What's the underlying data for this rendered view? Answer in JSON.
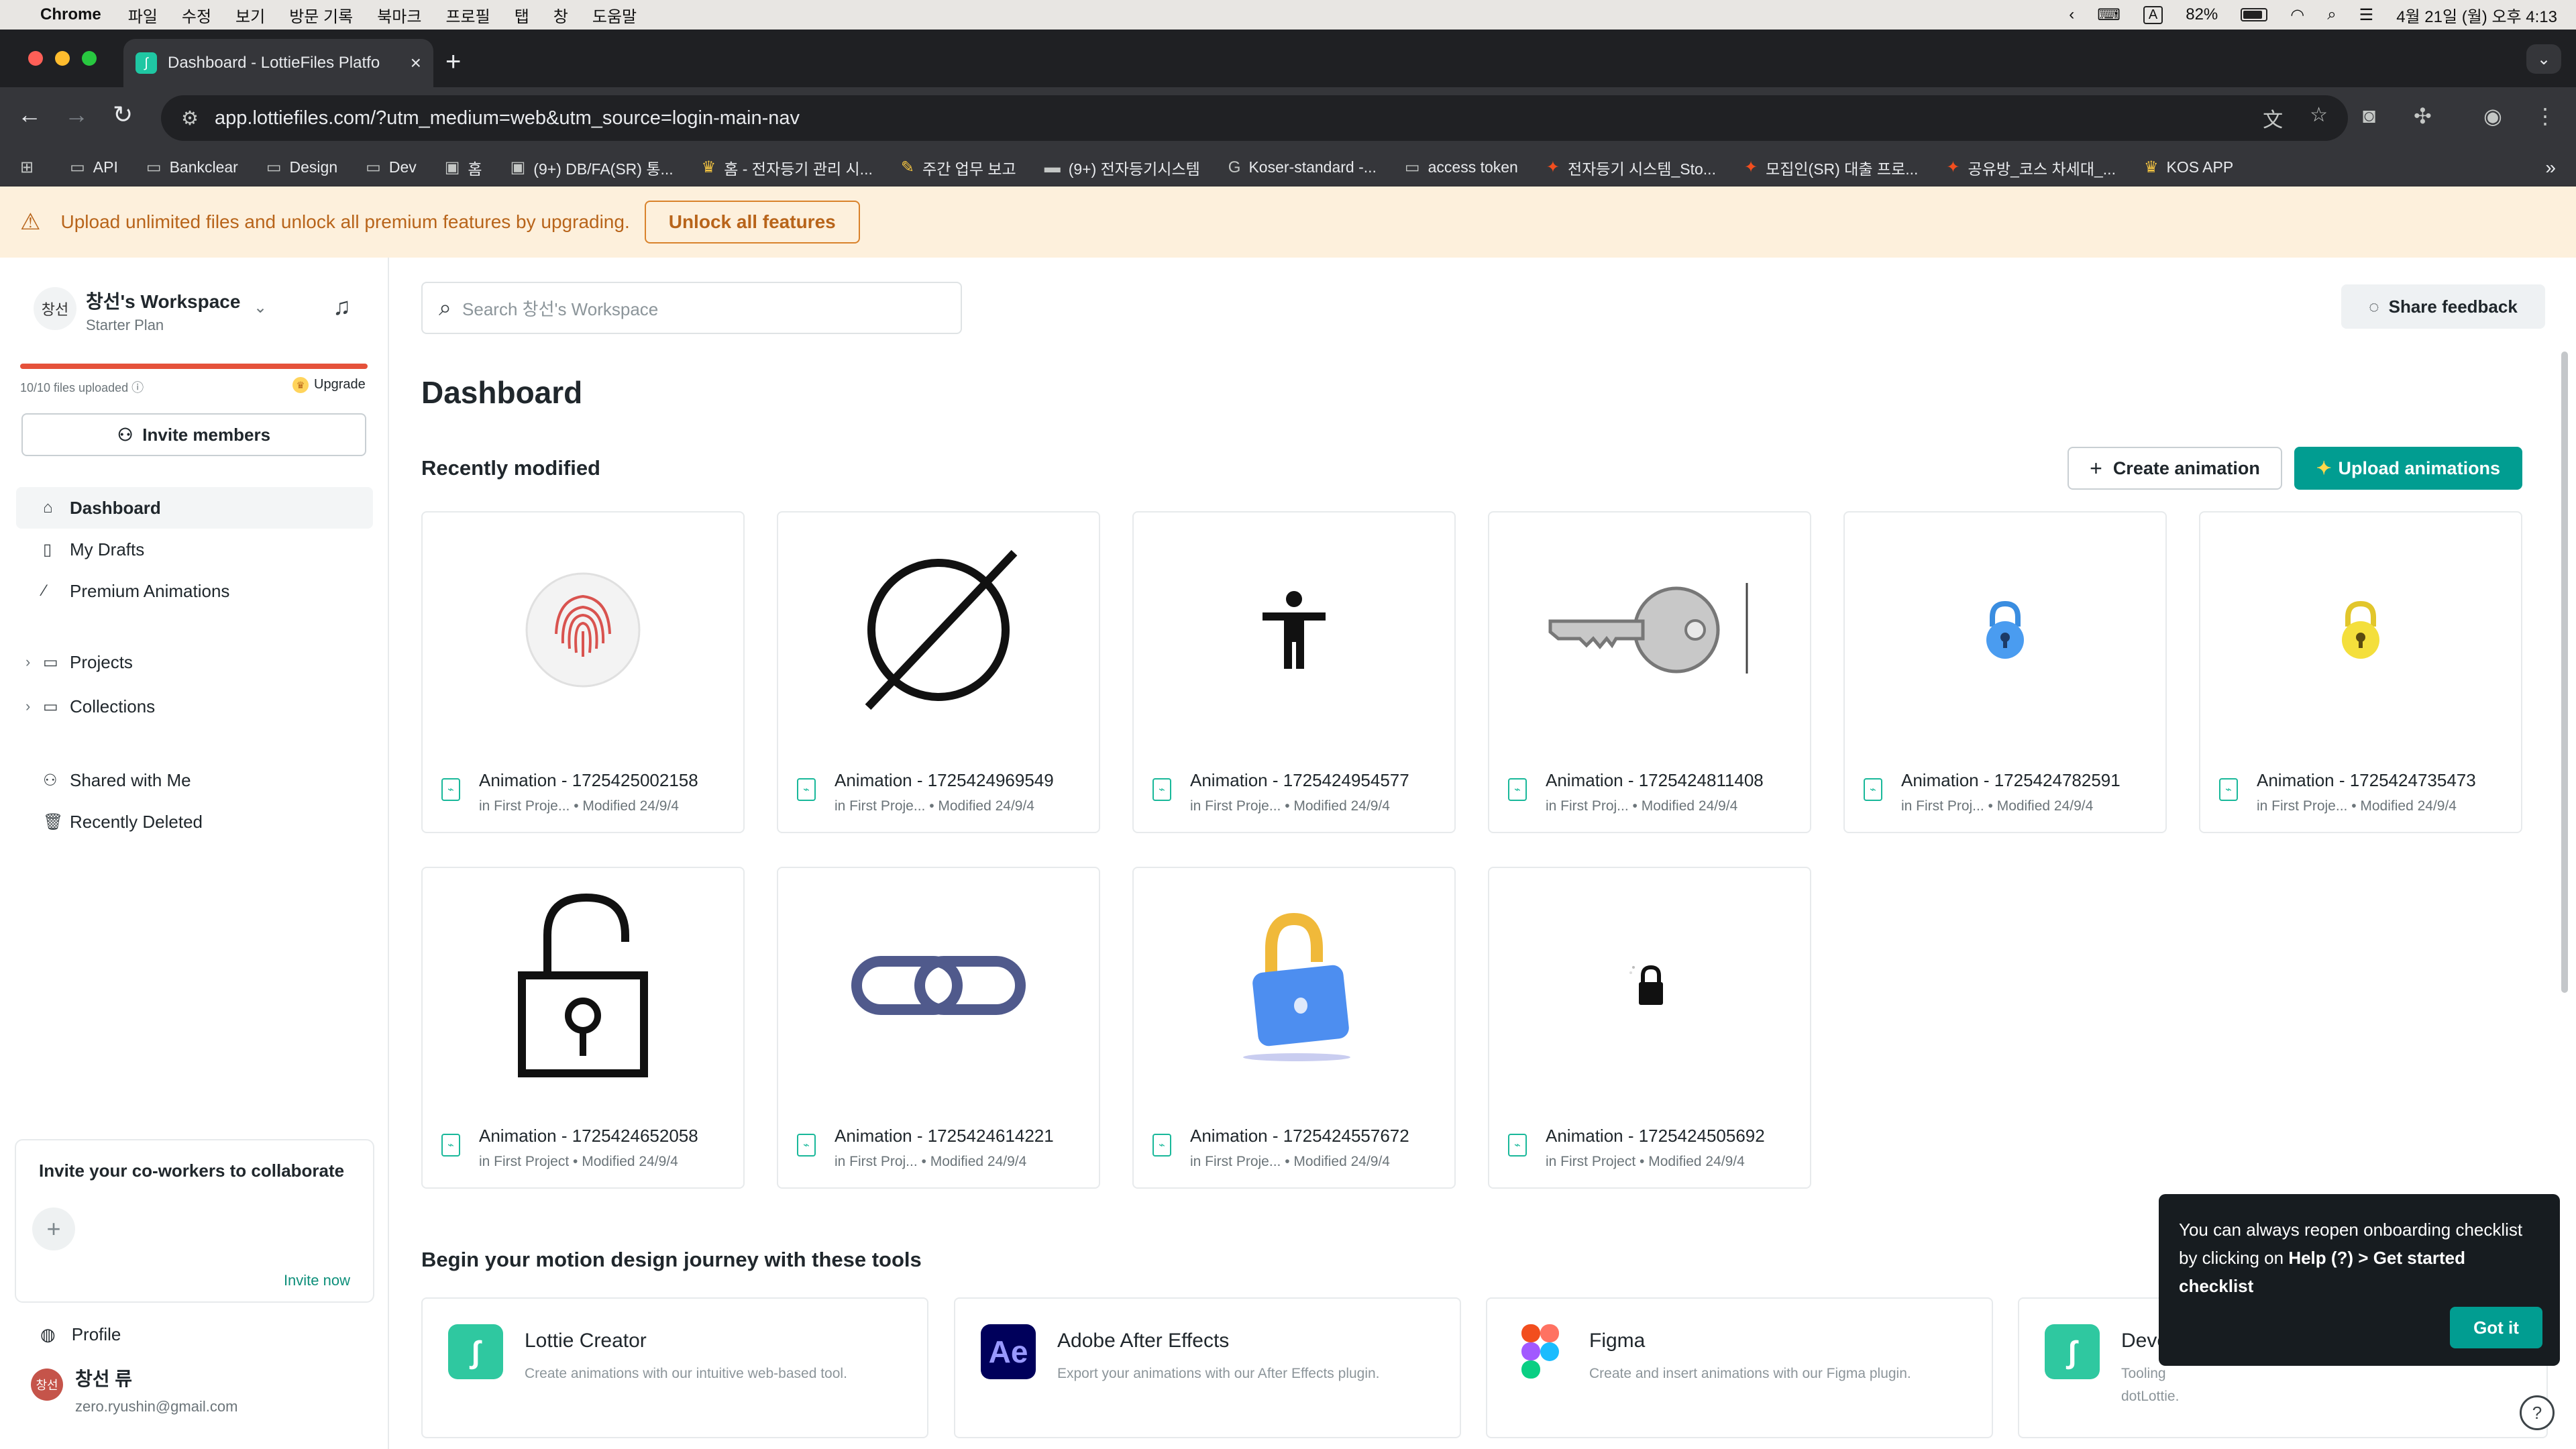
{
  "menubar": {
    "app": "Chrome",
    "items": [
      "파일",
      "수정",
      "보기",
      "방문 기록",
      "북마크",
      "프로필",
      "탭",
      "창",
      "도움말"
    ],
    "battery": "82%",
    "datetime": "4월 21일 (월) 오후 4:13"
  },
  "browser": {
    "tab_title": "Dashboard - LottieFiles Platfo",
    "url": "app.lottiefiles.com/?utm_medium=web&utm_source=login-main-nav",
    "bookmarks": [
      "API",
      "Bankclear",
      "Design",
      "Dev",
      "홈",
      "(9+) DB/FA(SR) 통...",
      "홈 - 전자등기 관리 시...",
      "주간 업무 보고",
      "(9+) 전자등기시스템",
      "Koser-standard -...",
      "access token",
      "전자등기 시스템_Sto...",
      "모집인(SR) 대출 프로...",
      "공유방_코스 차세대_...",
      "KOS APP"
    ]
  },
  "banner": {
    "text": "Upload unlimited files and unlock all premium features by upgrading.",
    "button": "Unlock all features"
  },
  "sidebar": {
    "avatar_text": "창선",
    "workspace_name": "창선's Workspace",
    "plan": "Starter Plan",
    "quota_text": "10/10 files uploaded",
    "quota_fraction": 1.0,
    "upgrade": "Upgrade",
    "invite_members": "Invite members",
    "nav": {
      "dashboard": "Dashboard",
      "drafts": "My Drafts",
      "premium": "Premium Animations",
      "projects": "Projects",
      "collections": "Collections",
      "shared": "Shared with Me",
      "deleted": "Recently Deleted"
    },
    "cowork_title": "Invite your co-workers to collaborate",
    "invite_now": "Invite now",
    "profile": "Profile",
    "user_avatar": "창선",
    "user_name": "창선 류",
    "user_email": "zero.ryushin@gmail.com"
  },
  "main": {
    "search_placeholder": "Search 창선's Workspace",
    "share_feedback": "Share feedback",
    "title": "Dashboard",
    "recent_title": "Recently modified",
    "create_animation": "Create animation",
    "upload_animations": "Upload animations",
    "animations": [
      {
        "name": "Animation - 1725425002158",
        "meta": "in First Proje... • Modified 24/9/4",
        "thumb": "fingerprint-icon"
      },
      {
        "name": "Animation - 1725424969549",
        "meta": "in First Proje... • Modified 24/9/4",
        "thumb": "empty-set-icon"
      },
      {
        "name": "Animation - 1725424954577",
        "meta": "in First Proje... • Modified 24/9/4",
        "thumb": "person-icon"
      },
      {
        "name": "Animation - 1725424811408",
        "meta": "in First Proj... • Modified 24/9/4",
        "thumb": "key-icon"
      },
      {
        "name": "Animation - 1725424782591",
        "meta": "in First Proj... • Modified 24/9/4",
        "thumb": "blue-lock-icon"
      },
      {
        "name": "Animation - 1725424735473",
        "meta": "in First Proje... • Modified 24/9/4",
        "thumb": "yellow-lock-icon"
      },
      {
        "name": "Animation - 1725424652058",
        "meta": "in First Project • Modified 24/9/4",
        "thumb": "unlocked-padlock-icon"
      },
      {
        "name": "Animation - 1725424614221",
        "meta": "in First Proj... • Modified 24/9/4",
        "thumb": "chain-link-icon"
      },
      {
        "name": "Animation - 1725424557672",
        "meta": "in First Proje... • Modified 24/9/4",
        "thumb": "3d-lock-icon"
      },
      {
        "name": "Animation - 1725424505692",
        "meta": "in First Project • Modified 24/9/4",
        "thumb": "small-lock-icon"
      }
    ],
    "tools_title": "Begin your motion design journey with these tools",
    "tools": [
      {
        "name": "Lottie Creator",
        "desc": "Create animations with our intuitive web-based tool.",
        "logo": "lottie-creator-icon",
        "color": "#2fc8a0"
      },
      {
        "name": "Adobe After Effects",
        "desc": "Export your animations with our After Effects plugin.",
        "logo": "after-effects-icon",
        "color": "#00005b"
      },
      {
        "name": "Figma",
        "desc": "Create and insert animations with our Figma plugin.",
        "logo": "figma-icon",
        "color": "#ffffff"
      },
      {
        "name": "Deve",
        "desc": "Tooling",
        "desc2": "dotLottie.",
        "logo": "developer-icon",
        "color": "#2fc8a0"
      }
    ]
  },
  "toast": {
    "text_1": "You can always reopen onboarding checklist by clicking on ",
    "text_bold": "Help (?) > Get started checklist",
    "button": "Got it"
  }
}
